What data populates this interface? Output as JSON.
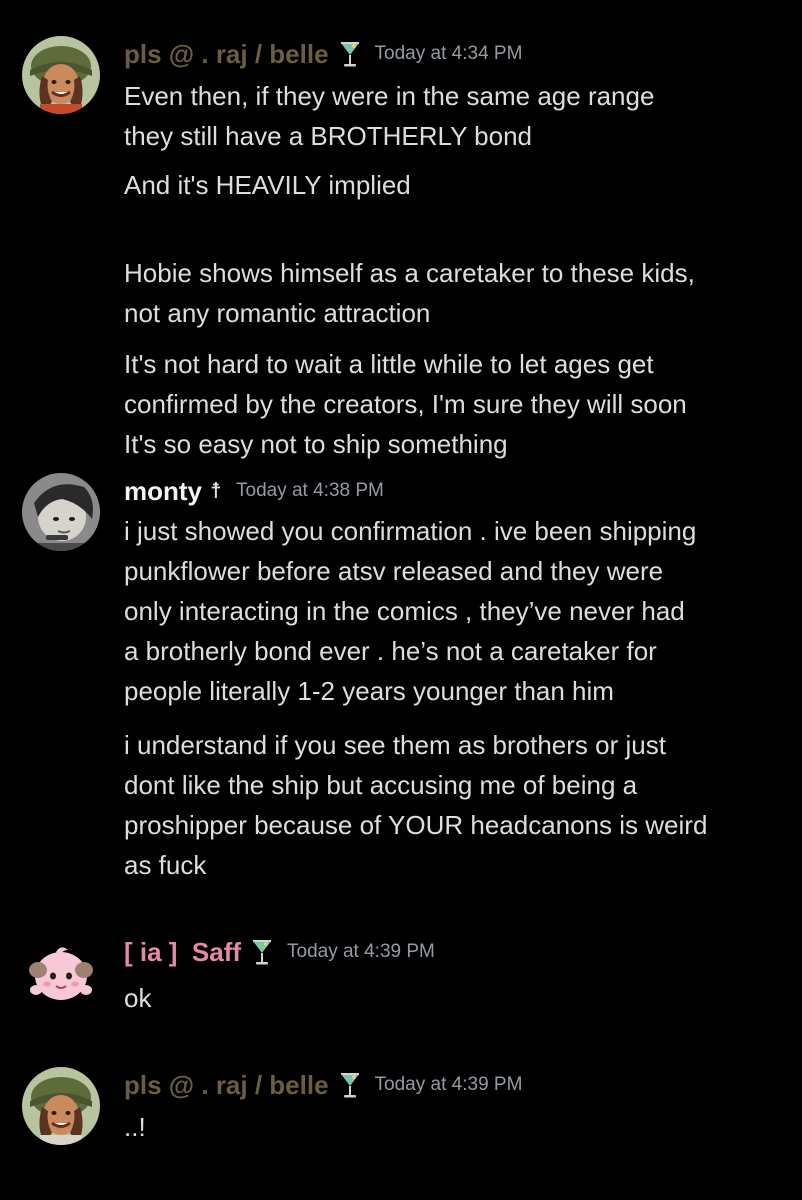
{
  "messages": [
    {
      "username": "pls @ . raj / belle",
      "badge_icon": "cocktail-icon",
      "timestamp": "Today at 4:34 PM",
      "paragraphs": [
        [
          "Even then, if they were in the same age range",
          "they still have a BROTHERLY bond"
        ],
        [
          "And it's HEAVILY implied"
        ],
        [
          "Hobie shows himself as a caretaker to these kids,",
          "not any romantic attraction"
        ],
        [
          "It's not hard to wait a little while to let ages get",
          "confirmed by the creators, I'm sure they will soon",
          "It's so easy not to ship something"
        ]
      ]
    },
    {
      "username": "monty",
      "badge_icon": "cross-icon",
      "badge_text": "☨",
      "timestamp": "Today at 4:38 PM",
      "paragraphs": [
        [
          "i just showed you confirmation . ive been shipping",
          "punkflower before atsv released and they were",
          "only interacting in the comics , they’ve never had",
          "a brotherly bond ever . he’s not a caretaker for",
          "people literally 1-2 years younger than him"
        ],
        [
          "i understand if you see them as brothers or just",
          "dont like the ship but accusing me of being a",
          "proshipper because of YOUR headcanons is weird",
          "as fuck"
        ]
      ]
    },
    {
      "username": "[ ia ]  Saff",
      "badge_icon": "cocktail-icon",
      "timestamp": "Today at 4:39 PM",
      "paragraphs": [
        [
          "ok"
        ]
      ]
    },
    {
      "username": "pls @ . raj / belle",
      "badge_icon": "cocktail-icon",
      "timestamp": "Today at 4:39 PM",
      "paragraphs": [
        [
          "..!"
        ]
      ]
    }
  ]
}
